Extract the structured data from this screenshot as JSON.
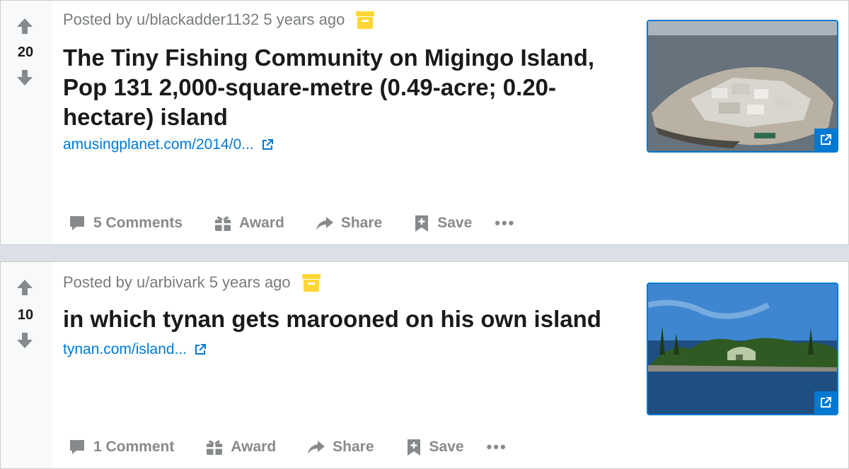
{
  "posts": [
    {
      "score": "20",
      "meta": {
        "prefix": "Posted by",
        "user": "u/blackadder1132",
        "time": "5 years ago"
      },
      "title": "The Tiny Fishing Community on Migingo Island, Pop 131 2,000-square-metre (0.49-acre; 0.20-hectare) island",
      "link": "amusingplanet.com/2014/0...",
      "thumbnail_icon": "external-link-icon",
      "actions": {
        "comments": "5 Comments",
        "award": "Award",
        "share": "Share",
        "save": "Save",
        "more": "•••"
      }
    },
    {
      "score": "10",
      "meta": {
        "prefix": "Posted by",
        "user": "u/arbivark",
        "time": "5 years ago"
      },
      "title": "in which tynan gets marooned on his own island",
      "link": "tynan.com/island...",
      "thumbnail_icon": "external-link-icon",
      "actions": {
        "comments": "1 Comment",
        "award": "Award",
        "share": "Share",
        "save": "Save",
        "more": "•••"
      }
    }
  ],
  "colors": {
    "link": "#0079d3",
    "muted": "#878a8c",
    "archive": "#ffd635",
    "vote_arrow": "#878a8c"
  }
}
